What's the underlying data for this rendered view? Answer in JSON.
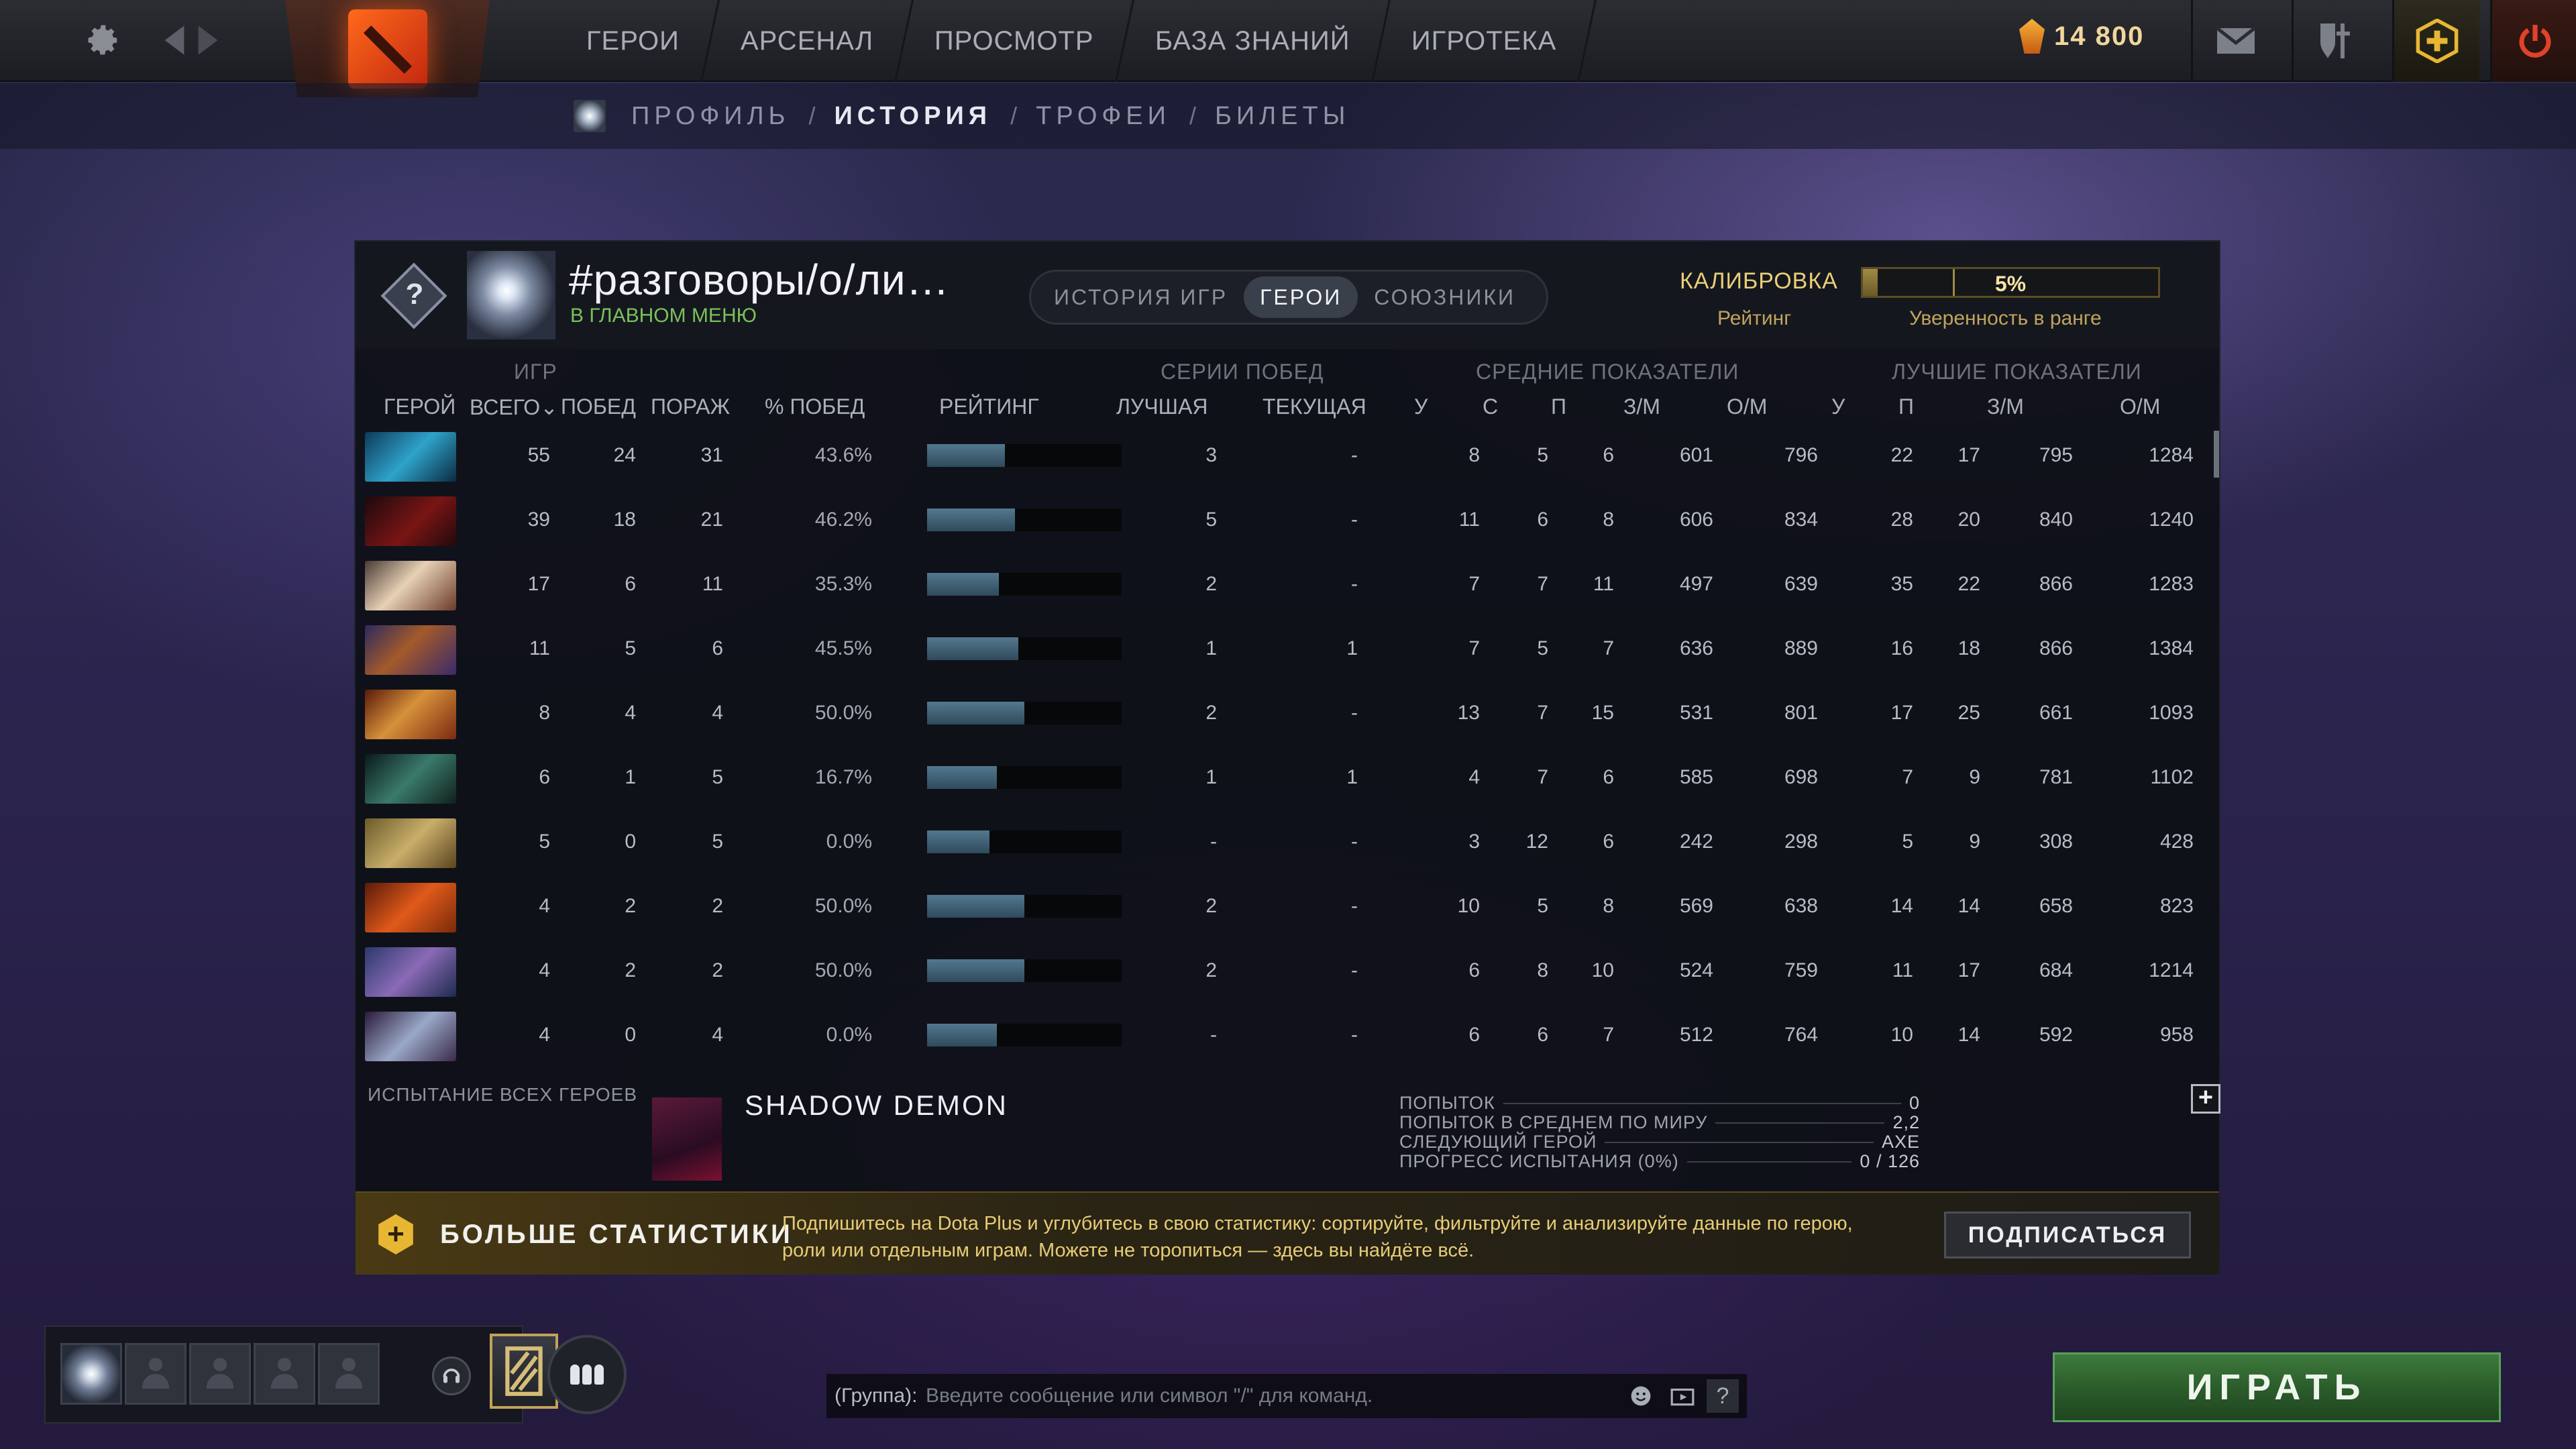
{
  "colors": {
    "accent_gold": "#e9cf77",
    "status_green": "#79c15a",
    "rating_bar": "#53788e",
    "play_green": "#3d7a3c",
    "dota_plus_gold": "#e7b734"
  },
  "topbar": {
    "nav": [
      "ГЕРОИ",
      "АРСЕНАЛ",
      "ПРОСМОТР",
      "БАЗА ЗНАНИЙ",
      "ИГРОТЕКА"
    ],
    "shards": "14 800",
    "icons": [
      "gear-icon",
      "back-icon",
      "forward-icon",
      "mail-icon",
      "armory-icon",
      "dota-plus-icon",
      "power-icon"
    ]
  },
  "subnav": {
    "items": [
      "ПРОФИЛЬ",
      "ИСТОРИЯ",
      "ТРОФЕИ",
      "БИЛЕТЫ"
    ],
    "active": "ИСТОРИЯ",
    "separator": "/"
  },
  "profile": {
    "rank_symbol": "?",
    "name": "#разговоры/о/ли…",
    "status": "В ГЛАВНОМ МЕНЮ",
    "tabs": [
      "ИСТОРИЯ ИГР",
      "ГЕРОИ",
      "СОЮЗНИКИ"
    ],
    "active_tab": "ГЕРОИ",
    "calibration_label": "КАЛИБРОВКА",
    "rating_label": "Рейтинг",
    "confidence_value": "5%",
    "confidence_fraction": 0.05,
    "confidence_label": "Уверенность в ранге"
  },
  "table": {
    "group_headers": {
      "games": "ИГР",
      "streaks": "СЕРИИ ПОБЕД",
      "averages": "СРЕДНИЕ ПОКАЗАТЕЛИ",
      "best": "ЛУЧШИЕ ПОКАЗАТЕЛИ"
    },
    "columns": {
      "hero": "ГЕРОЙ",
      "total": "ВСЕГО",
      "wins": "ПОБЕД",
      "losses": "ПОРАЖ",
      "winrate": "% ПОБЕД",
      "rating": "РЕЙТИНГ",
      "best_streak": "ЛУЧШАЯ",
      "current_streak": "ТЕКУЩАЯ",
      "avg_kills": "У",
      "avg_deaths": "С",
      "avg_assists": "П",
      "avg_gpm": "З/М",
      "avg_xpm": "О/М",
      "best_kills": "У",
      "best_assists": "П",
      "best_gpm": "З/М",
      "best_xpm": "О/М"
    },
    "sort_indicator": "⌄",
    "rows": [
      {
        "hero": "morphling",
        "total": "55",
        "wins": "24",
        "losses": "31",
        "winrate": "43.6%",
        "rating": 0.4,
        "best_streak": "3",
        "current_streak": "-",
        "ak": "8",
        "ad": "5",
        "aa": "6",
        "agpm": "601",
        "axpm": "796",
        "bk": "22",
        "ba": "17",
        "bgpm": "795",
        "bxpm": "1284"
      },
      {
        "hero": "shadow-fiend",
        "total": "39",
        "wins": "18",
        "losses": "21",
        "winrate": "46.2%",
        "rating": 0.45,
        "best_streak": "5",
        "current_streak": "-",
        "ak": "11",
        "ad": "6",
        "aa": "8",
        "agpm": "606",
        "axpm": "834",
        "bk": "28",
        "ba": "20",
        "bgpm": "840",
        "bxpm": "1240"
      },
      {
        "hero": "invoker",
        "total": "17",
        "wins": "6",
        "losses": "11",
        "winrate": "35.3%",
        "rating": 0.37,
        "best_streak": "2",
        "current_streak": "-",
        "ak": "7",
        "ad": "7",
        "aa": "11",
        "agpm": "497",
        "axpm": "639",
        "bk": "35",
        "ba": "22",
        "bgpm": "866",
        "bxpm": "1283"
      },
      {
        "hero": "anti-mage",
        "total": "11",
        "wins": "5",
        "losses": "6",
        "winrate": "45.5%",
        "rating": 0.47,
        "best_streak": "1",
        "current_streak": "1",
        "ak": "7",
        "ad": "5",
        "aa": "7",
        "agpm": "636",
        "axpm": "889",
        "bk": "16",
        "ba": "18",
        "bgpm": "866",
        "bxpm": "1384"
      },
      {
        "hero": "legion-commander",
        "total": "8",
        "wins": "4",
        "losses": "4",
        "winrate": "50.0%",
        "rating": 0.5,
        "best_streak": "2",
        "current_streak": "-",
        "ak": "13",
        "ad": "7",
        "aa": "15",
        "agpm": "531",
        "axpm": "801",
        "bk": "17",
        "ba": "25",
        "bgpm": "661",
        "bxpm": "1093"
      },
      {
        "hero": "terrorblade",
        "total": "6",
        "wins": "1",
        "losses": "5",
        "winrate": "16.7%",
        "rating": 0.36,
        "best_streak": "1",
        "current_streak": "1",
        "ak": "4",
        "ad": "7",
        "aa": "6",
        "agpm": "585",
        "axpm": "698",
        "bk": "7",
        "ba": "9",
        "bgpm": "781",
        "bxpm": "1102"
      },
      {
        "hero": "bristleback",
        "total": "5",
        "wins": "0",
        "losses": "5",
        "winrate": "0.0%",
        "rating": 0.32,
        "best_streak": "-",
        "current_streak": "-",
        "ak": "3",
        "ad": "12",
        "aa": "6",
        "agpm": "242",
        "axpm": "298",
        "bk": "5",
        "ba": "9",
        "bgpm": "308",
        "bxpm": "428"
      },
      {
        "hero": "ember-spirit",
        "total": "4",
        "wins": "2",
        "losses": "2",
        "winrate": "50.0%",
        "rating": 0.5,
        "best_streak": "2",
        "current_streak": "-",
        "ak": "10",
        "ad": "5",
        "aa": "8",
        "agpm": "569",
        "axpm": "638",
        "bk": "14",
        "ba": "14",
        "bgpm": "658",
        "bxpm": "823"
      },
      {
        "hero": "faceless-void",
        "total": "4",
        "wins": "2",
        "losses": "2",
        "winrate": "50.0%",
        "rating": 0.5,
        "best_streak": "2",
        "current_streak": "-",
        "ak": "6",
        "ad": "8",
        "aa": "10",
        "agpm": "524",
        "axpm": "759",
        "bk": "11",
        "ba": "17",
        "bgpm": "684",
        "bxpm": "1214"
      },
      {
        "hero": "templar-assassin",
        "total": "4",
        "wins": "0",
        "losses": "4",
        "winrate": "0.0%",
        "rating": 0.36,
        "best_streak": "-",
        "current_streak": "-",
        "ak": "6",
        "ad": "6",
        "aa": "7",
        "agpm": "512",
        "axpm": "764",
        "bk": "10",
        "ba": "14",
        "bgpm": "592",
        "bxpm": "958"
      }
    ]
  },
  "challenge": {
    "label": "ИСПЫТАНИЕ ВСЕХ ГЕРОЕВ",
    "hero_name": "SHADOW DEMON",
    "stats": [
      {
        "label": "ПОПЫТОК",
        "value": "0"
      },
      {
        "label": "ПОПЫТОК В СРЕДНЕМ ПО МИРУ",
        "value": "2,2"
      },
      {
        "label": "СЛЕДУЮЩИЙ ГЕРОЙ",
        "value": "AXE"
      },
      {
        "label": "ПРОГРЕСС ИСПЫТАНИЯ (0%)",
        "value": "0 / 126"
      }
    ],
    "expand": "+"
  },
  "promo": {
    "icon": "+",
    "title": "БОЛЬШЕ СТАТИСТИКИ",
    "text": "Подпишитесь на Dota Plus и углубитесь в свою статистику: сортируйте, фильтруйте и анализируйте данные по герою, роли или отдельным играм. Можете не торопиться — здесь вы найдёте всё.",
    "button": "ПОДПИСАТЬСЯ"
  },
  "bottom": {
    "chat_label": "(Группа):",
    "chat_placeholder": "Введите сообщение или символ \"/\" для команд.",
    "help": "?",
    "play": "ИГРАТЬ"
  }
}
